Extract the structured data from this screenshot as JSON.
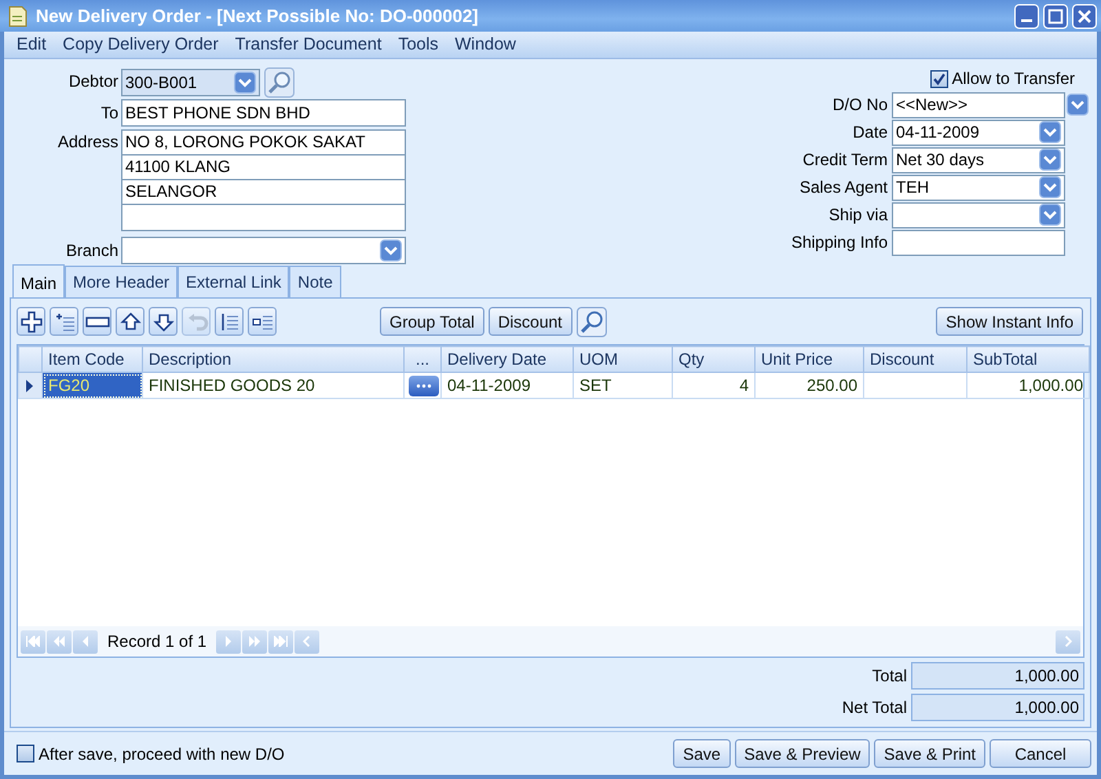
{
  "window": {
    "title": "New Delivery Order - [Next Possible No: DO-000002]"
  },
  "menu": [
    "Edit",
    "Copy Delivery Order",
    "Transfer Document",
    "Tools",
    "Window"
  ],
  "left_fields": {
    "debtor": {
      "label": "Debtor",
      "value": "300-B001"
    },
    "to": {
      "label": "To",
      "value": "BEST PHONE SDN BHD"
    },
    "address": {
      "label": "Address",
      "lines": [
        "NO 8, LORONG POKOK SAKAT",
        "41100 KLANG",
        "SELANGOR"
      ]
    },
    "branch": {
      "label": "Branch"
    }
  },
  "allow_transfer": {
    "label": "Allow to Transfer",
    "checked": true
  },
  "right_fields": [
    {
      "label": "D/O No",
      "value": "<<New>>",
      "kind": "combo-outside"
    },
    {
      "label": "Date",
      "value": "04-11-2009",
      "kind": "combo"
    },
    {
      "label": "Credit Term",
      "value": "Net 30 days",
      "kind": "combo"
    },
    {
      "label": "Sales Agent",
      "value": "TEH",
      "kind": "combo"
    },
    {
      "label": "Ship via",
      "kind": "combo"
    },
    {
      "label": "Shipping Info",
      "kind": "text"
    }
  ],
  "tabs": [
    {
      "label": "Main",
      "selected": true
    },
    {
      "label": "More Header",
      "selected": false
    },
    {
      "label": "External Link",
      "selected": false
    },
    {
      "label": "Note",
      "selected": false
    }
  ],
  "toolbar": {
    "icon_buttons": [
      {
        "disabled": false
      },
      {
        "disabled": false
      },
      {
        "disabled": false
      },
      {
        "disabled": false
      },
      {
        "disabled": false
      },
      {
        "disabled": true
      },
      {
        "disabled": false
      },
      {
        "disabled": false
      }
    ],
    "buttons": [
      "Group Total",
      "Discount"
    ],
    "right_button": "Show Instant Info"
  },
  "table": {
    "columns": [
      {
        "label": "Item Code",
        "kind": "text"
      },
      {
        "label": "Description",
        "kind": "text"
      },
      {
        "label": "...",
        "kind": "button"
      },
      {
        "label": "Delivery Date",
        "kind": "text"
      },
      {
        "label": "UOM",
        "kind": "text"
      },
      {
        "label": "Qty",
        "kind": "number"
      },
      {
        "label": "Unit Price",
        "kind": "number"
      },
      {
        "label": "Discount",
        "kind": "number"
      },
      {
        "label": "SubTotal",
        "kind": "number"
      }
    ],
    "rows": [
      {
        "selected": true,
        "cells": [
          "FG20",
          "FINISHED GOODS 20",
          null,
          "04-11-2009",
          "SET",
          "4",
          "250.00",
          null,
          "1,000.00"
        ]
      }
    ]
  },
  "navigator": {
    "record": "Record 1 of 1"
  },
  "totals": [
    {
      "label": "Total",
      "value": "1,000.00"
    },
    {
      "label": "Net Total",
      "value": "1,000.00"
    }
  ],
  "proceed_new": {
    "label": "After save, proceed with new D/O",
    "checked": false
  },
  "buttons": [
    "Save",
    "Save & Preview",
    "Save & Print",
    "Cancel"
  ]
}
